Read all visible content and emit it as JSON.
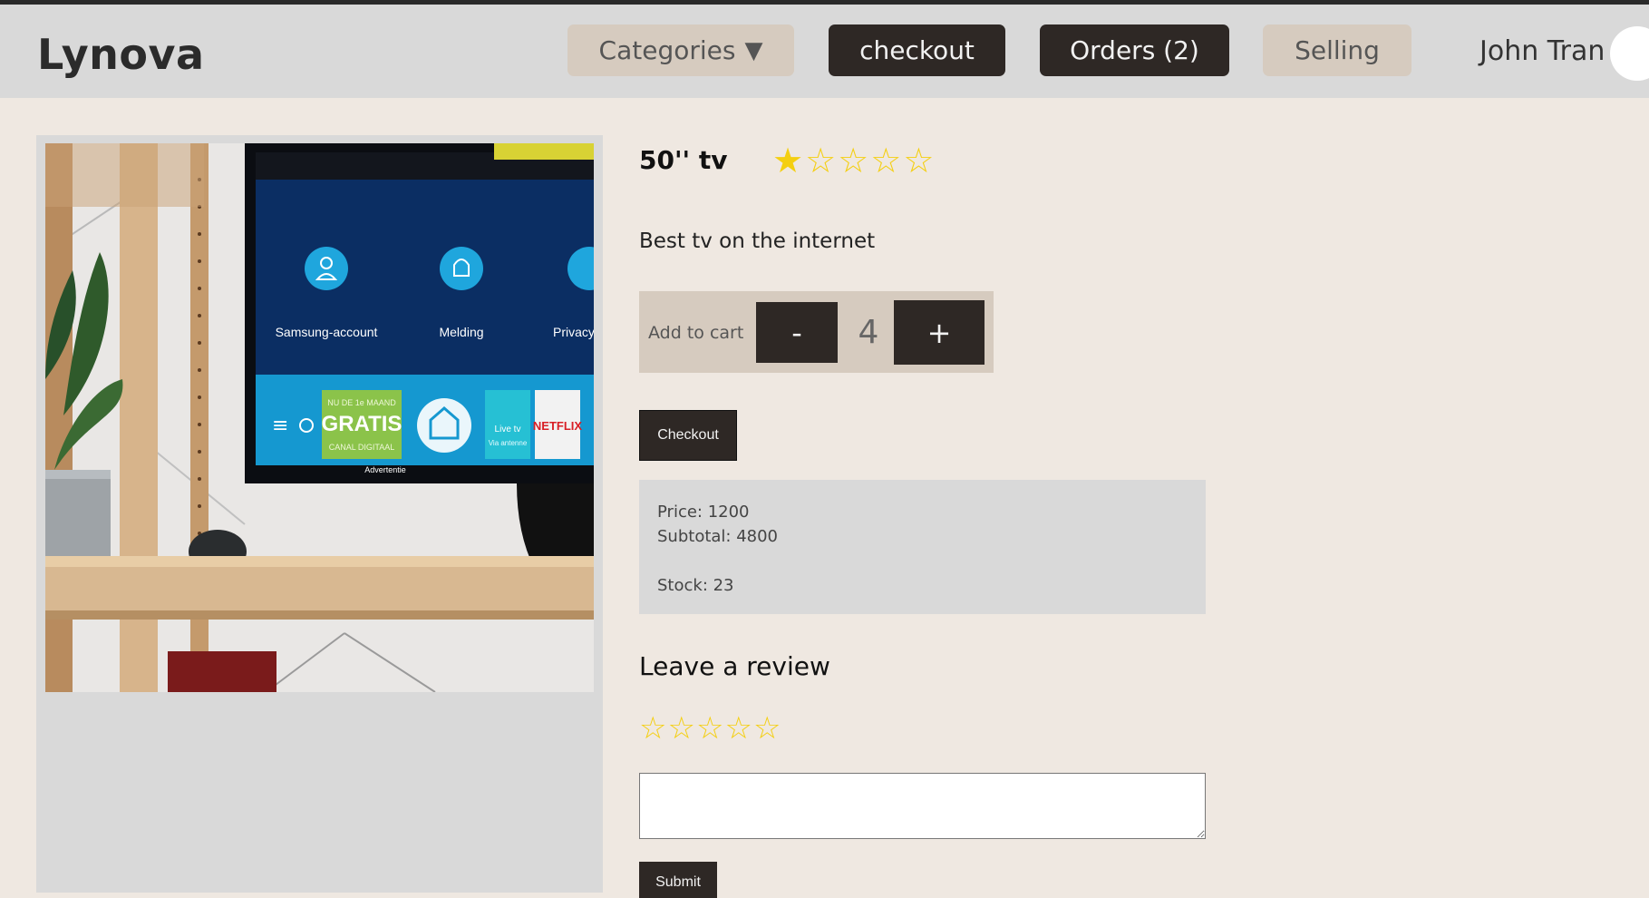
{
  "brand": {
    "logo_text": "Lynova"
  },
  "nav": {
    "categories_label": "Categories",
    "categories_caret": "▼",
    "checkout_label": "checkout",
    "orders_label": "Orders (2)",
    "selling_label": "Selling",
    "user_name": "John Tran"
  },
  "product": {
    "title": "50'' tv",
    "rating": 1,
    "rating_max": 5,
    "description": "Best tv on the internet",
    "image_screen_labels": [
      "Samsung-account",
      "Melding",
      "Privacyv"
    ],
    "image_tile_labels": {
      "promo_top": "NU DE 1e MAAND",
      "promo_main": "GRATIS",
      "promo_bottom": "CANAL DIGITAAL",
      "advert": "Advertentie",
      "live_top": "Live tv",
      "live_bottom": "Via antenne",
      "netflix": "NETFLIX"
    }
  },
  "cart": {
    "label": "Add to cart",
    "minus_label": "-",
    "quantity": "4",
    "plus_label": "+"
  },
  "checkout_button": {
    "label": "Checkout"
  },
  "info": {
    "price": "Price: 1200",
    "subtotal": "Subtotal: 4800",
    "stock": "Stock: 23"
  },
  "review": {
    "heading": "Leave a review",
    "rating": 0,
    "rating_max": 5,
    "textarea_value": "",
    "submit_label": "Submit"
  },
  "colors": {
    "page_bg": "#efe8e1",
    "navbar_bg": "#d9d9d9",
    "dark_button": "#2e2825",
    "light_button": "#d6cbbf",
    "star": "#f4cf11"
  }
}
